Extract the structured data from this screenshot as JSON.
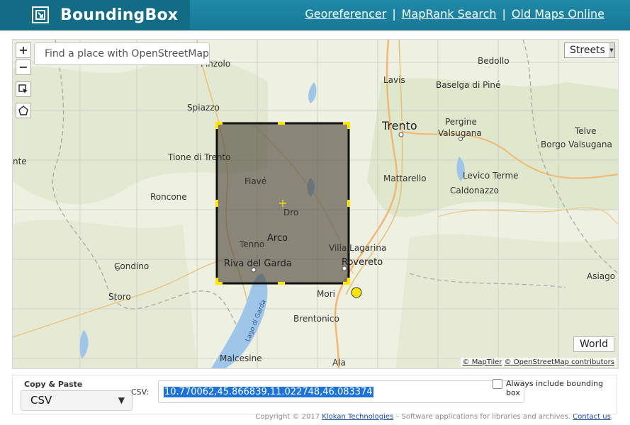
{
  "app": {
    "title": "BoundingBox"
  },
  "nav": {
    "links": [
      "Georeferencer",
      "MapRank Search",
      "Old Maps Online"
    ],
    "separator": "|"
  },
  "map": {
    "search_placeholder": "Find a place with OpenStreetMap",
    "zoom_in": "+",
    "zoom_out": "−",
    "layer": "Streets",
    "world_button": "World",
    "attribution": [
      "© MapTiler",
      "© OpenStreetMap contributors"
    ],
    "labels": {
      "trento": "Trento",
      "rovereto": "Rovereto",
      "arco": "Arco",
      "riva": "Riva del Garda",
      "pinzolo": "Pinzolo",
      "spiazzo": "Spiazzo",
      "tione": "Tione di Trento",
      "fiave": "Fiavé",
      "roncone": "Roncone",
      "dro": "Dro",
      "tenno": "Tenno",
      "condino": "Condino",
      "storo": "Storo",
      "mori": "Mori",
      "brentonico": "Brentonico",
      "villa_lagarina": "Villa Lagarina",
      "mattarello": "Mattarello",
      "lavis": "Lavis",
      "baselga": "Baselga di Piné",
      "bedollo": "Bedollo",
      "pergine": "Pergine",
      "valsugana": "Valsugana",
      "levico": "Levico Terme",
      "caldonazzo": "Caldonazzo",
      "borgo": "Borgo Valsugana",
      "telve": "Telve",
      "asiago": "Asiago",
      "malcesine": "Malcesine",
      "ala": "Ala",
      "lago_di_garda": "Lago di Garda",
      "edge_nte": "nte"
    },
    "colors": {
      "water": "#9fc5e8",
      "bbox_fill": "#4a4438",
      "handle": "#ffe600"
    }
  },
  "panel": {
    "copy_label": "Copy & Paste",
    "format": "CSV",
    "csv_label": "CSV:",
    "coordinates": "10.770062,45.866839,11.022748,46.083374",
    "always_include_label": "Always include bounding box"
  },
  "footer": {
    "copyright": "Copyright © 2017",
    "company": "Klokan Technologies",
    "tagline": " – Software applications for libraries and archives.",
    "contact": "Contact us",
    "end": "."
  }
}
